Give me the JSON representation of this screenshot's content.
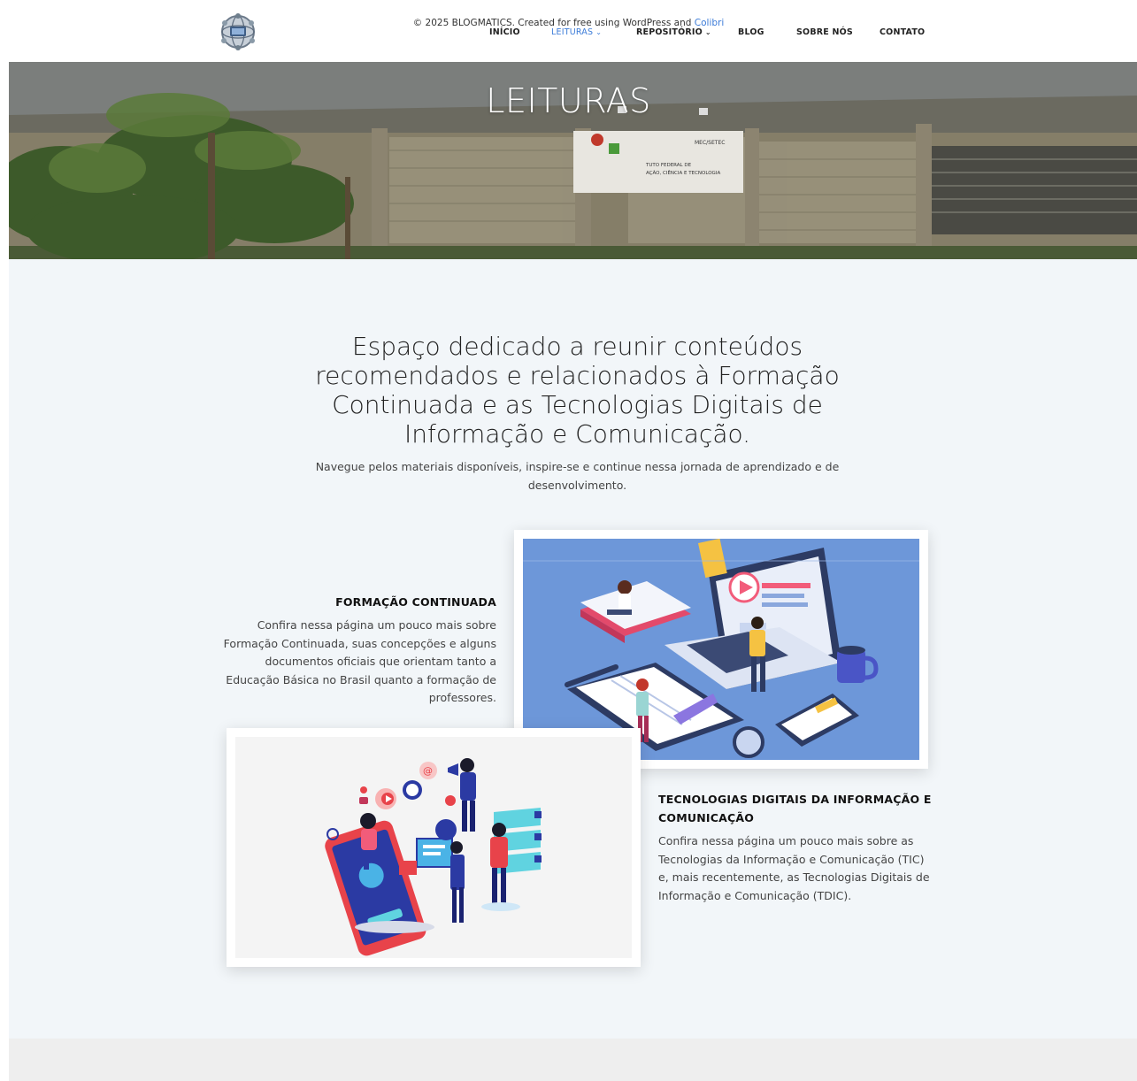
{
  "nav": {
    "items": [
      {
        "label": "INÍCIO"
      },
      {
        "label": "LEITURAS"
      },
      {
        "label": "REPOSITÓRIO"
      },
      {
        "label": "BLOG"
      },
      {
        "label": "SOBRE NÓS"
      },
      {
        "label": "CONTATO"
      }
    ],
    "dropdown_icon": "chevron-down-icon"
  },
  "hero": {
    "title": "LEITURAS",
    "sign_text": "MEC/SETEC",
    "sign_line1": "TUTO FEDERAL DE",
    "sign_line2": "AÇÃO, CIÊNCIA E TECNOLOGIA"
  },
  "main": {
    "heading": "Espaço dedicado a reunir conteúdos recomendados e relacionados à Formação Continuada e as Tecnologias Digitais de Informação e Comunicação.",
    "subheading": "Navegue pelos materiais disponíveis, inspire-se e continue nessa jornada de aprendizado e de desenvolvimento."
  },
  "sections": [
    {
      "title": "FORMAÇÃO CONTINUADA",
      "text": "Confira nessa página um pouco mais sobre Formação Continuada, suas concepções e alguns documentos oficiais que orientam tanto a Educação Básica no Brasil quanto a formação de professores."
    },
    {
      "title": "TECNOLOGIAS DIGITAIS DA INFORMAÇÃO E COMUNICAÇÃO",
      "text": "Confira nessa página um pouco mais sobre as Tecnologias da Informação e Comunicação (TIC) e, mais recentemente, as Tecnologias Digitais de Informação e Comunicação (TDIC)."
    }
  ],
  "footer": {
    "text": "© 2025 BLOGMATICS. Created for free using WordPress and",
    "link": "Colibri"
  },
  "colors": {
    "accent": "#3b7bd8",
    "main_bg": "#f2f6f9",
    "footer_bg": "#eeeeee"
  }
}
